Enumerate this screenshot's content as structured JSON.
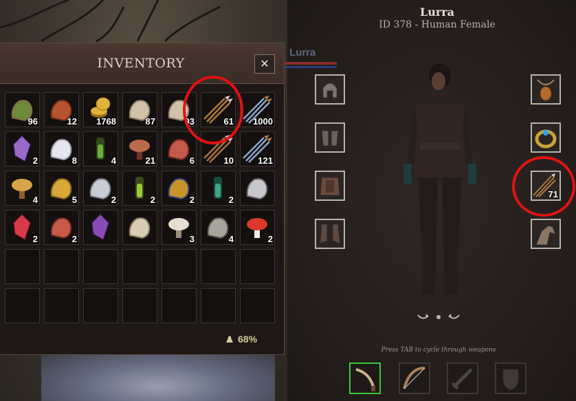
{
  "character": {
    "name": "Lurra",
    "subtitle": "ID 378 - Human Female",
    "overhead_name": "Lurra"
  },
  "inventory": {
    "title": "INVENTORY",
    "close_label": "✕",
    "weight_percent": "68%",
    "items": [
      {
        "name": "herb-pot-icon",
        "count": "96"
      },
      {
        "name": "raw-meat-icon",
        "count": "12"
      },
      {
        "name": "gold-coins-icon",
        "count": "1768"
      },
      {
        "name": "leather-scraps-icon",
        "count": "87"
      },
      {
        "name": "leather-scraps-icon",
        "count": "93"
      },
      {
        "name": "arrows-icon",
        "count": "61"
      },
      {
        "name": "steel-arrows-icon",
        "count": "1000"
      },
      {
        "name": "purple-crystal-icon",
        "count": "2"
      },
      {
        "name": "white-fur-icon",
        "count": "8"
      },
      {
        "name": "poison-vial-icon",
        "count": "4"
      },
      {
        "name": "red-mushroom-cluster-icon",
        "count": "21"
      },
      {
        "name": "coral-fungus-icon",
        "count": "6"
      },
      {
        "name": "arrows-bundle-icon",
        "count": "10"
      },
      {
        "name": "steel-arrows-icon",
        "count": "121"
      },
      {
        "name": "yellow-mushrooms-icon",
        "count": "4"
      },
      {
        "name": "golden-fungus-icon",
        "count": "5"
      },
      {
        "name": "silver-ore-icon",
        "count": "2"
      },
      {
        "name": "green-vial-icon",
        "count": "2"
      },
      {
        "name": "tarot-cards-icon",
        "count": "2"
      },
      {
        "name": "green-potion-icon",
        "count": "2"
      },
      {
        "name": "iron-ingot-icon",
        "count": ""
      },
      {
        "name": "red-crystal-icon",
        "count": "2"
      },
      {
        "name": "red-root-icon",
        "count": "2"
      },
      {
        "name": "amethyst-icon",
        "count": ""
      },
      {
        "name": "bone-fang-icon",
        "count": ""
      },
      {
        "name": "white-mushrooms-icon",
        "count": "3"
      },
      {
        "name": "stone-icon",
        "count": "4"
      },
      {
        "name": "fly-agaric-icon",
        "count": "2"
      }
    ]
  },
  "equipment": {
    "left": [
      {
        "name": "helmet-slot"
      },
      {
        "name": "gloves-slot"
      },
      {
        "name": "armor-slot"
      },
      {
        "name": "boots-slot"
      }
    ],
    "right": [
      {
        "name": "amulet-slot",
        "count": ""
      },
      {
        "name": "ring-slot",
        "count": ""
      },
      {
        "name": "ammo-slot",
        "count": "71"
      },
      {
        "name": "mount-slot",
        "count": ""
      }
    ]
  },
  "weapons": {
    "hint": "Press TAB to cycle through weapons",
    "slots": [
      "sword-curved-icon",
      "bow-icon",
      "sword-empty-icon",
      "shield-empty-icon"
    ],
    "active_index": 0
  },
  "colors": {
    "highlight": "#e11212",
    "active_weapon": "#3cc63c",
    "weight_text": "#d8c79a"
  }
}
